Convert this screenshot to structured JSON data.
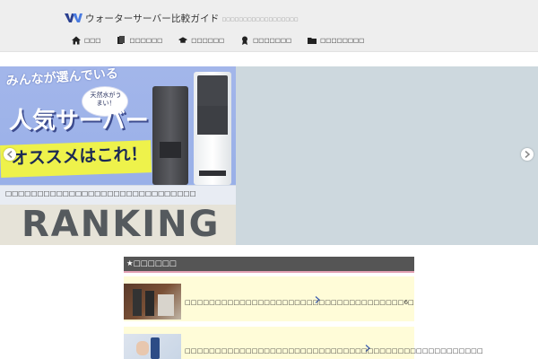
{
  "header": {
    "site_title": "ウォーターサーバー比較ガイド",
    "tagline": "□□□□□□□□□□□□□□□□□□",
    "logo_icon": "wg-logo-icon"
  },
  "nav": {
    "items": [
      {
        "icon": "home-icon",
        "label": "□□□"
      },
      {
        "icon": "book-icon",
        "label": "□□□□□□"
      },
      {
        "icon": "graduation-cap-icon",
        "label": "□□□□□□"
      },
      {
        "icon": "award-icon",
        "label": "□□□□□□□"
      },
      {
        "icon": "folder-icon",
        "label": "□□□□□□□□"
      }
    ]
  },
  "slider": {
    "slide1": {
      "headline_small": "みんなが選んでいる",
      "headline_big": "人気サーバー",
      "bubble": "天然水がうまい！",
      "banner_text": "オススメはこれ！",
      "caption": "□□□□□□□□□□□□□□□□□□□□□□□□□□□□□□"
    },
    "slide2": {
      "banner_text": "RANKING"
    },
    "prev_icon": "chevron-left-icon",
    "next_icon": "chevron-right-icon"
  },
  "ranking": {
    "header": "★□□□□□□",
    "cards": [
      {
        "text": "□□□□□□□□□□□□□□□□□□□□□□□□□□□□□□□□□□□□6□"
      },
      {
        "text": "□□□□□□□□□□□□□□□□□□□□□□□□□□□□□□□□□□□□□□□□□□□□□□□□□"
      }
    ]
  },
  "colors": {
    "header_bg": "#eeeeee",
    "slider_bg": "#cdd8de",
    "ranking_header_bg": "#555555",
    "ranking_header_underline": "#e3a0b3",
    "card_bg": "#fffcd8"
  }
}
